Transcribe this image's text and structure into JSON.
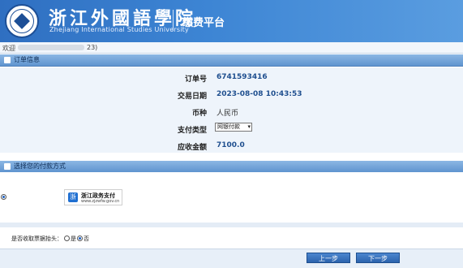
{
  "header": {
    "university_cn": "浙江外國語學院",
    "university_en": "Zhejiang International Studies University",
    "app_title": "缴费平台"
  },
  "welcome": {
    "prefix": "欢迎",
    "suffix": "23)"
  },
  "order_section": {
    "title": "订单信息",
    "fields": [
      {
        "label": "订单号",
        "value": "6741593416"
      },
      {
        "label": "交易日期",
        "value": "2023-08-08 10:43:53"
      },
      {
        "label": "币种",
        "value": "人民币"
      },
      {
        "label": "支付类型",
        "value": "网银付款"
      },
      {
        "label": "应收金额",
        "value": "7100.0"
      }
    ]
  },
  "payment_section": {
    "title": "选择您的付款方式",
    "method_name": "浙江政务支付",
    "method_url": "www.zjzwfw.gov.cn"
  },
  "receipt": {
    "question": "是否收取票据抬头：",
    "yes": "是",
    "no": "否"
  },
  "buttons": {
    "prev": "上一步",
    "next": "下一步"
  }
}
